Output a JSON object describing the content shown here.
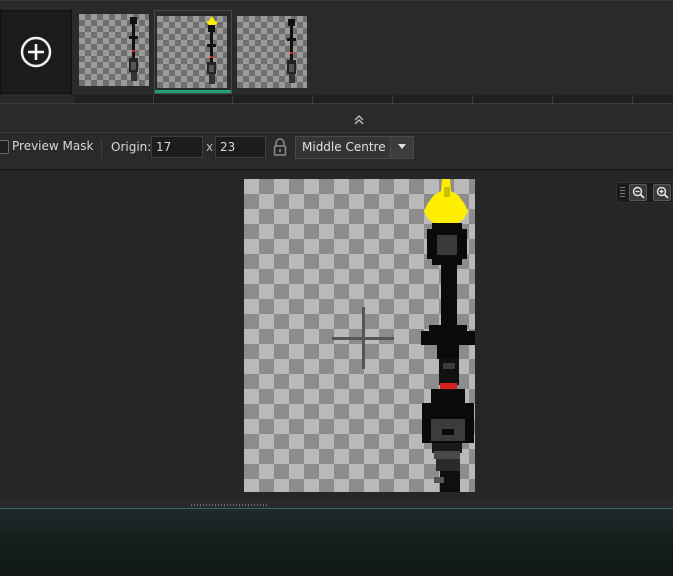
{
  "frame_strip": {
    "add_frame_icon": "plus-circle-icon",
    "frames": [
      {
        "label": "frame-1",
        "selected": false,
        "has_flame": false
      },
      {
        "label": "frame-2",
        "selected": true,
        "has_flame": true
      },
      {
        "label": "frame-3",
        "selected": false,
        "has_flame": false
      }
    ],
    "selected_color": "#1fa07a"
  },
  "splitter": {
    "collapse_icon": "double-chevron-up-icon"
  },
  "toolbar": {
    "preview_mask_label": "Preview Mask",
    "preview_mask_checked": false,
    "origin_label": "Origin:",
    "origin_x": "17",
    "origin_separator": "x",
    "origin_y": "23",
    "lock_icon": "lock-icon",
    "anchor_value": "Middle Centre",
    "anchor_dropdown_icon": "chevron-down-icon"
  },
  "canvas": {
    "origin_marker_icon": "crosshair-icon",
    "zoom_out_icon": "zoom-out-icon",
    "zoom_in_icon": "zoom-in-icon",
    "flame_color": "#ffee00",
    "accent_red": "#e02020"
  }
}
